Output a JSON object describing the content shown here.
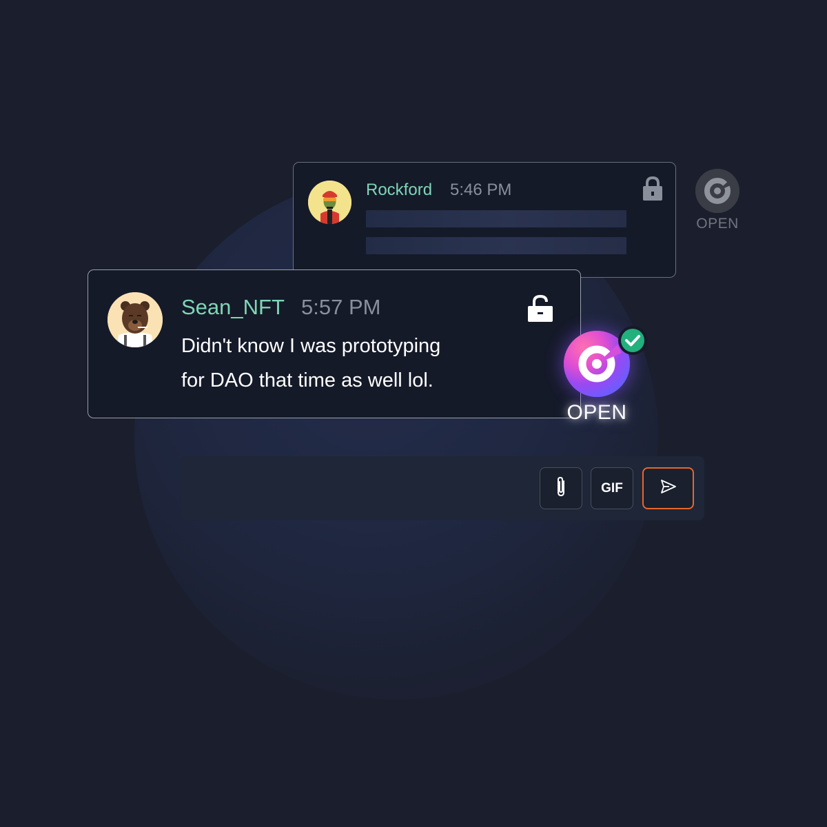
{
  "colors": {
    "background": "#1b1e2c",
    "username": "#7fd6b5",
    "timestamp": "#8a8f9c",
    "send_border": "#e8672c",
    "verified_check": "#22b07d"
  },
  "messages": [
    {
      "username": "Rockford",
      "time": "5:46 PM",
      "locked": true,
      "lock_icon": "lock-icon",
      "badge": {
        "label": "OPEN",
        "state": "inactive"
      }
    },
    {
      "username": "Sean_NFT",
      "time": "5:57 PM",
      "locked": false,
      "lock_icon": "unlock-icon",
      "text_line1": "Didn't know I was prototyping",
      "text_line2": "for DAO that time as well lol.",
      "badge": {
        "label": "OPEN",
        "state": "active",
        "verified": true
      }
    }
  ],
  "composer": {
    "attach_icon": "paperclip-icon",
    "gif_label": "GIF",
    "send_icon": "send-icon"
  }
}
